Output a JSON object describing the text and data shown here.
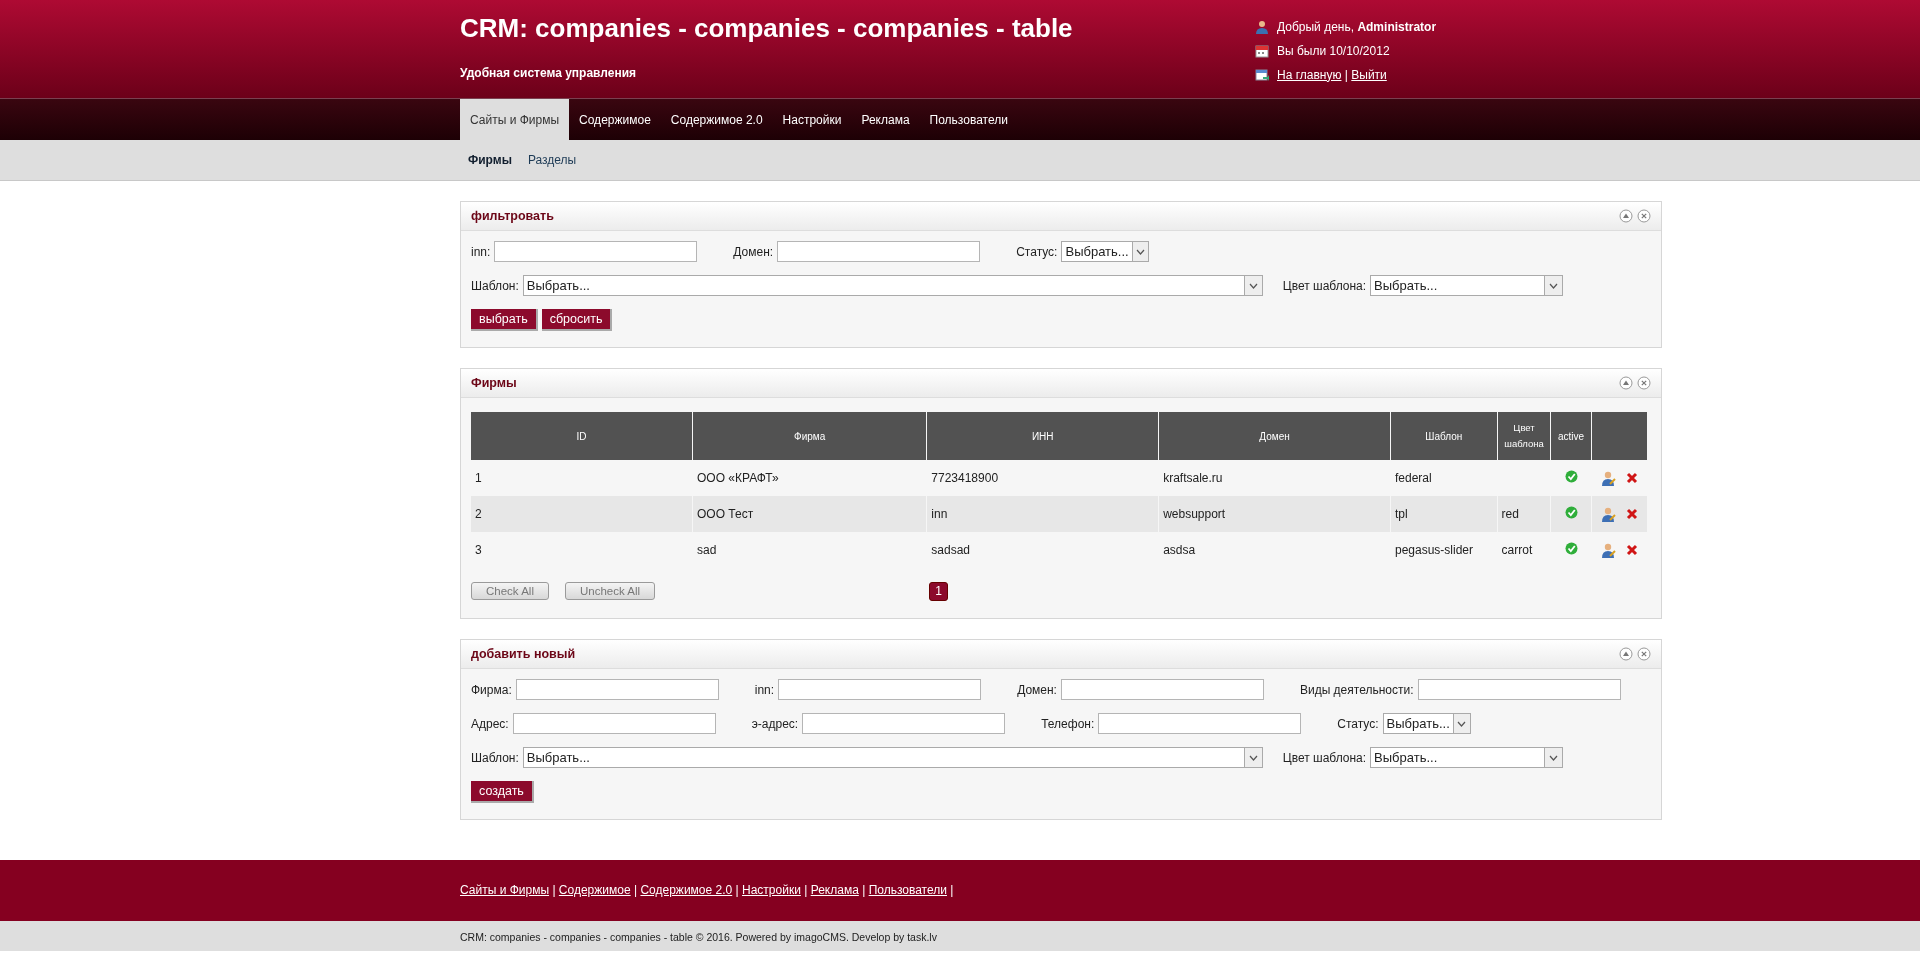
{
  "header": {
    "title": "CRM: companies - companies - companies - table",
    "subtitle": "Удобная система управления",
    "greeting": "Добрый день, **Administrator**",
    "last_visit": "Вы были 10/10/2012",
    "links": [
      "На главную",
      "Выйти"
    ],
    "separator": "|"
  },
  "nav": [
    {
      "label": "Сайты и Фирмы",
      "selected": true
    },
    {
      "label": "Содержимое",
      "selected": false
    },
    {
      "label": "Содержимое 2.0",
      "selected": false
    },
    {
      "label": "Настройки",
      "selected": false
    },
    {
      "label": "Реклама",
      "selected": false
    },
    {
      "label": "Пользователи",
      "selected": false
    }
  ],
  "subnav": [
    {
      "label": "Фирмы",
      "selected": true
    },
    {
      "label": "Разделы",
      "selected": false
    }
  ],
  "panels": [
    {
      "kind": "form",
      "title": "фильтровать",
      "rows": [
        [
          {
            "kind": "text",
            "label": "inn:"
          },
          {
            "kind": "text",
            "label": "Домен:"
          },
          {
            "kind": "short-select",
            "label": "Статус:",
            "value": "Выбрать..."
          }
        ]
      ],
      "template_line": {
        "template": {
          "label": "Шаблон:",
          "value": "Выбрать..."
        },
        "template_color": {
          "label": "Цвет шаблона:",
          "value": "Выбрать..."
        }
      },
      "buttons": [
        "выбрать",
        "сбросить"
      ]
    },
    {
      "kind": "table",
      "title": "Фирмы",
      "columns": [
        "ID",
        "Фирма",
        "ИНН",
        "Домен",
        "Шаблон",
        "Цвет шаблона",
        "active"
      ],
      "rows": [
        {
          "id": "1",
          "company": "ООО «КРАФТ»",
          "inn": "7723418900",
          "domain": "kraftsale.ru",
          "template": "federal",
          "active": true
        },
        {
          "id": "2",
          "company": "ООО Тест",
          "inn": "inn",
          "domain": "websupport",
          "template": "tpl",
          "template_color": "red",
          "active": true
        },
        {
          "id": "3",
          "company": "sad",
          "inn": "sadsad",
          "domain": "asdsa",
          "template": "pegasus-slider",
          "template_color": "carrot",
          "active": true
        }
      ],
      "buttons": [
        "Check All",
        "Uncheck All"
      ],
      "pages": [
        {
          "label": "1",
          "selected": true
        }
      ]
    },
    {
      "kind": "form",
      "title": "добавить новый",
      "rows": [
        [
          {
            "kind": "text",
            "label": "Фирма:"
          },
          {
            "kind": "text",
            "label": "inn:"
          },
          {
            "kind": "text",
            "label": "Домен:"
          },
          {
            "kind": "text",
            "label": "Виды деятельности:"
          }
        ],
        [
          {
            "kind": "text",
            "label": "Адрес:"
          },
          {
            "kind": "text",
            "label": "э-адрес:"
          },
          {
            "kind": "text",
            "label": "Телефон:"
          },
          {
            "kind": "short-select",
            "label": "Статус:",
            "value": "Выбрать..."
          }
        ]
      ],
      "template_line": {
        "template": {
          "label": "Шаблон:",
          "value": "Выбрать..."
        },
        "template_color": {
          "label": "Цвет шаблона:",
          "value": "Выбрать..."
        }
      },
      "buttons": [
        "создать"
      ]
    }
  ],
  "footer": {
    "links": [
      "Сайты и Фирмы",
      "Содержимое",
      "Содержимое 2.0",
      "Настройки",
      "Реклама",
      "Пользователи"
    ],
    "separator": "|",
    "copyright": "CRM: companies - companies - companies - table © 2016. Powered by imagoCMS. Develop by task.lv"
  }
}
